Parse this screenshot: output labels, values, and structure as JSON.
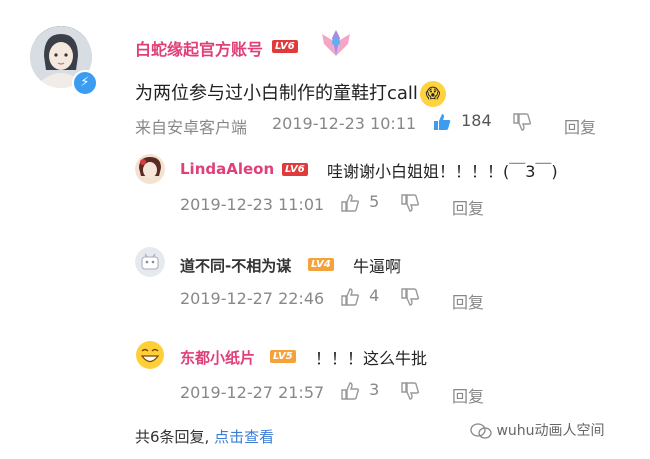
{
  "main_comment": {
    "username": "白蛇缘起官方账号",
    "level": "LV6",
    "content": "为两位参与过小白制作的童鞋打call",
    "source": "来自安卓客户端",
    "time": "2019-12-23 10:11",
    "likes": "184",
    "reply_label": "回复"
  },
  "replies": [
    {
      "username": "LindaAleon",
      "level": "LV6",
      "text": "哇谢谢小白姐姐！！！！(￣3￣)",
      "time": "2019-12-23 11:01",
      "likes": "5",
      "reply_label": "回复"
    },
    {
      "username": "道不同-不相为谋",
      "level": "LV4",
      "text": "牛逼啊",
      "time": "2019-12-27 22:46",
      "likes": "4",
      "reply_label": "回复"
    },
    {
      "username": "东都小纸片",
      "level": "LV5",
      "text": "！！！这么牛批",
      "time": "2019-12-27 21:57",
      "likes": "3",
      "reply_label": "回复"
    }
  ],
  "footer": {
    "total": "共6条回复,",
    "link": "点击查看"
  },
  "watermark": "wuhu动画人空间",
  "colors": {
    "username": "#e0407a",
    "like_active": "#3b9cf2",
    "link": "#3b7cd6"
  }
}
